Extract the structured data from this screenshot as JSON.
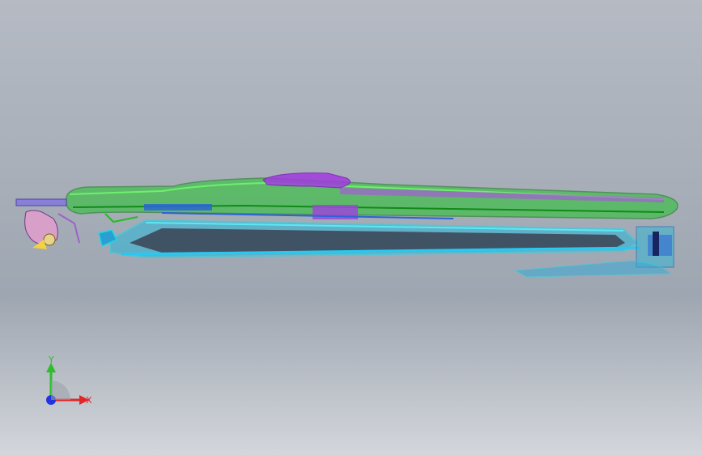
{
  "viewport": {
    "background_top": "#b5bac3",
    "background_bottom": "#d3d6db"
  },
  "model": {
    "colors": {
      "green_frame": "#1fbf1f",
      "green_dark": "#0f7a12",
      "purple": "#a13adf",
      "cyan": "#1fd6e8",
      "blue": "#2a64d6",
      "dark_panel": "#3b4352",
      "bracket": "#8a7fd6",
      "handle": "#d8a0c8"
    }
  },
  "triad": {
    "x_label": "X",
    "y_label": "Y",
    "x_color": "#e0262b",
    "y_color": "#2dbd2d",
    "z_color": "#2233e0"
  }
}
